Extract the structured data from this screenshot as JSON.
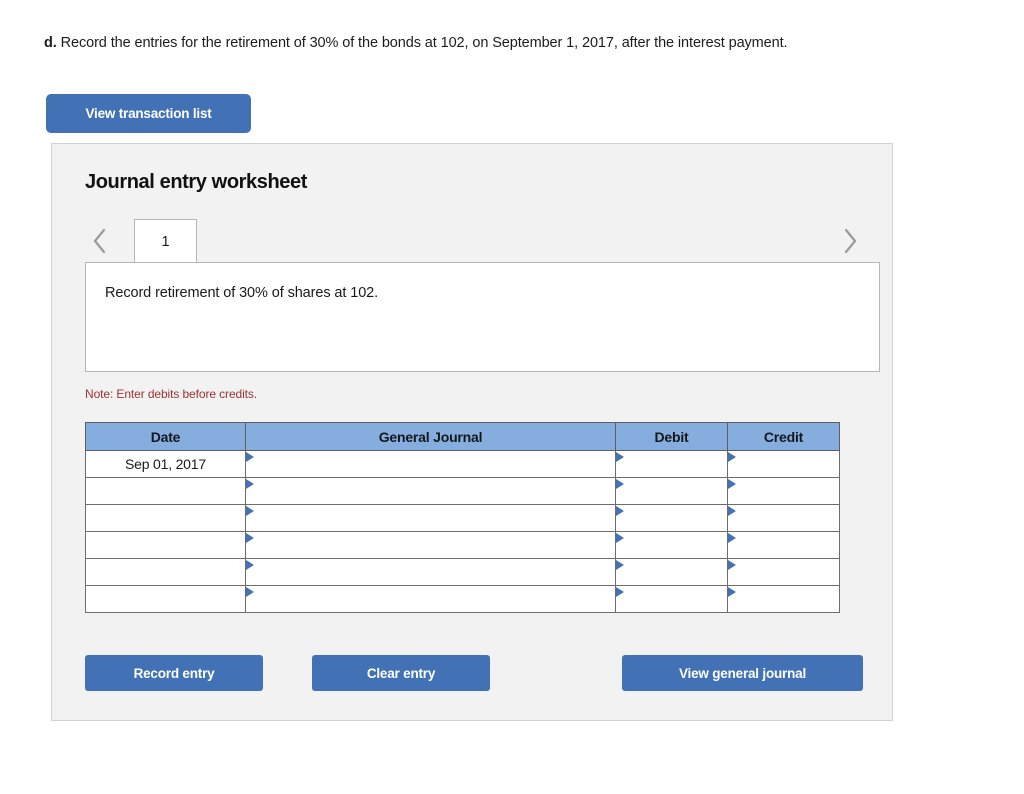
{
  "question": {
    "label": "d.",
    "text": "Record the entries for the retirement of 30% of the bonds at 102, on September 1, 2017, after the interest payment."
  },
  "toolbar": {
    "view_transaction_list_label": "View transaction list"
  },
  "worksheet": {
    "title": "Journal entry worksheet",
    "tabs": [
      {
        "label": "1",
        "active": true
      }
    ],
    "prev_arrow_icon": "chevron-left-icon",
    "next_arrow_icon": "chevron-right-icon",
    "instruction": "Record retirement of 30% of shares at 102.",
    "note": "Note: Enter debits before credits."
  },
  "table": {
    "columns": [
      "Date",
      "General Journal",
      "Debit",
      "Credit"
    ],
    "rows": [
      {
        "date": "Sep 01, 2017",
        "general_journal": "",
        "debit": "",
        "credit": ""
      },
      {
        "date": "",
        "general_journal": "",
        "debit": "",
        "credit": ""
      },
      {
        "date": "",
        "general_journal": "",
        "debit": "",
        "credit": ""
      },
      {
        "date": "",
        "general_journal": "",
        "debit": "",
        "credit": ""
      },
      {
        "date": "",
        "general_journal": "",
        "debit": "",
        "credit": ""
      },
      {
        "date": "",
        "general_journal": "",
        "debit": "",
        "credit": ""
      }
    ]
  },
  "footer": {
    "record_entry_label": "Record entry",
    "clear_entry_label": "Clear entry",
    "view_general_journal_label": "View general journal"
  },
  "colors": {
    "button_blue": "#4272b5",
    "table_header_blue": "#85aede",
    "note_red": "#9e3232",
    "panel_gray": "#f2f2f2",
    "marker_blue": "#4472b4"
  }
}
